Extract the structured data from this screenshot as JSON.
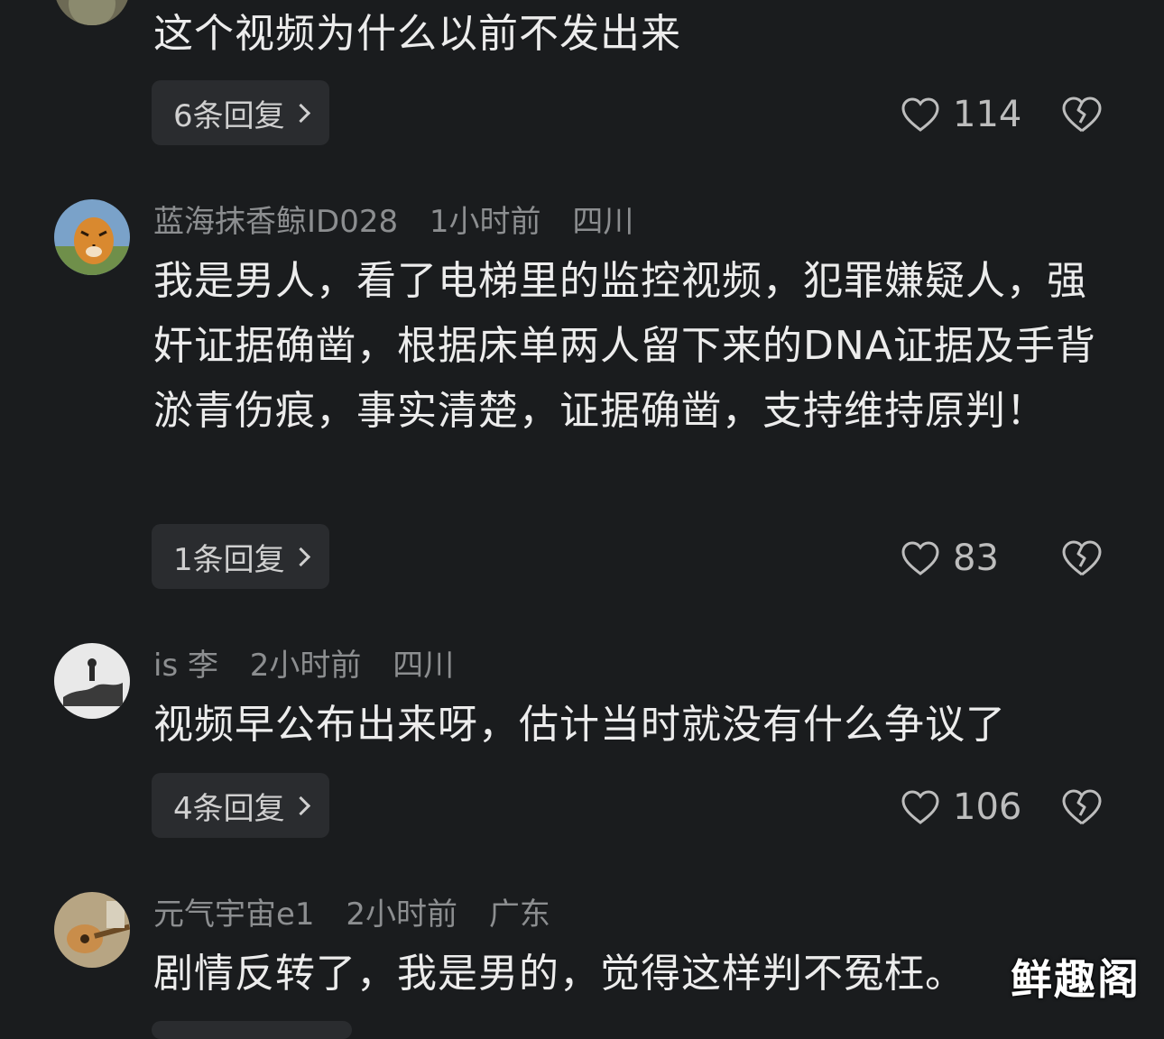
{
  "comments": [
    {
      "text": "这个视频为什么以前不发出来",
      "reply_label": "6条回复",
      "likes": "114"
    },
    {
      "user": "蓝海抹香鲸ID028",
      "time": "1小时前",
      "location": "四川",
      "text": "我是男人，看了电梯里的监控视频，犯罪嫌疑人，强奸证据确凿，根据床单两人留下来的DNA证据及手背淤青伤痕，事实清楚，证据确凿，支持维持原判！",
      "reply_label": "1条回复",
      "likes": "83"
    },
    {
      "user": "is 李",
      "time": "2小时前",
      "location": "四川",
      "text": "视频早公布出来呀，估计当时就没有什么争议了",
      "reply_label": "4条回复",
      "likes": "106"
    },
    {
      "user": "元气宇宙e1",
      "time": "2小时前",
      "location": "广东",
      "text": "剧情反转了，我是男的，觉得这样判不冤枉。"
    }
  ],
  "watermark": "鲜趣阁",
  "icons": {
    "like": "heart-outline-icon",
    "dislike": "broken-heart-icon",
    "reply_chevron": "chevron-right-icon"
  },
  "colors": {
    "background": "#1a1c1e",
    "meta_text": "#8c8e90",
    "body_text": "#ececec",
    "reply_button_bg": "#2a2c2f"
  }
}
